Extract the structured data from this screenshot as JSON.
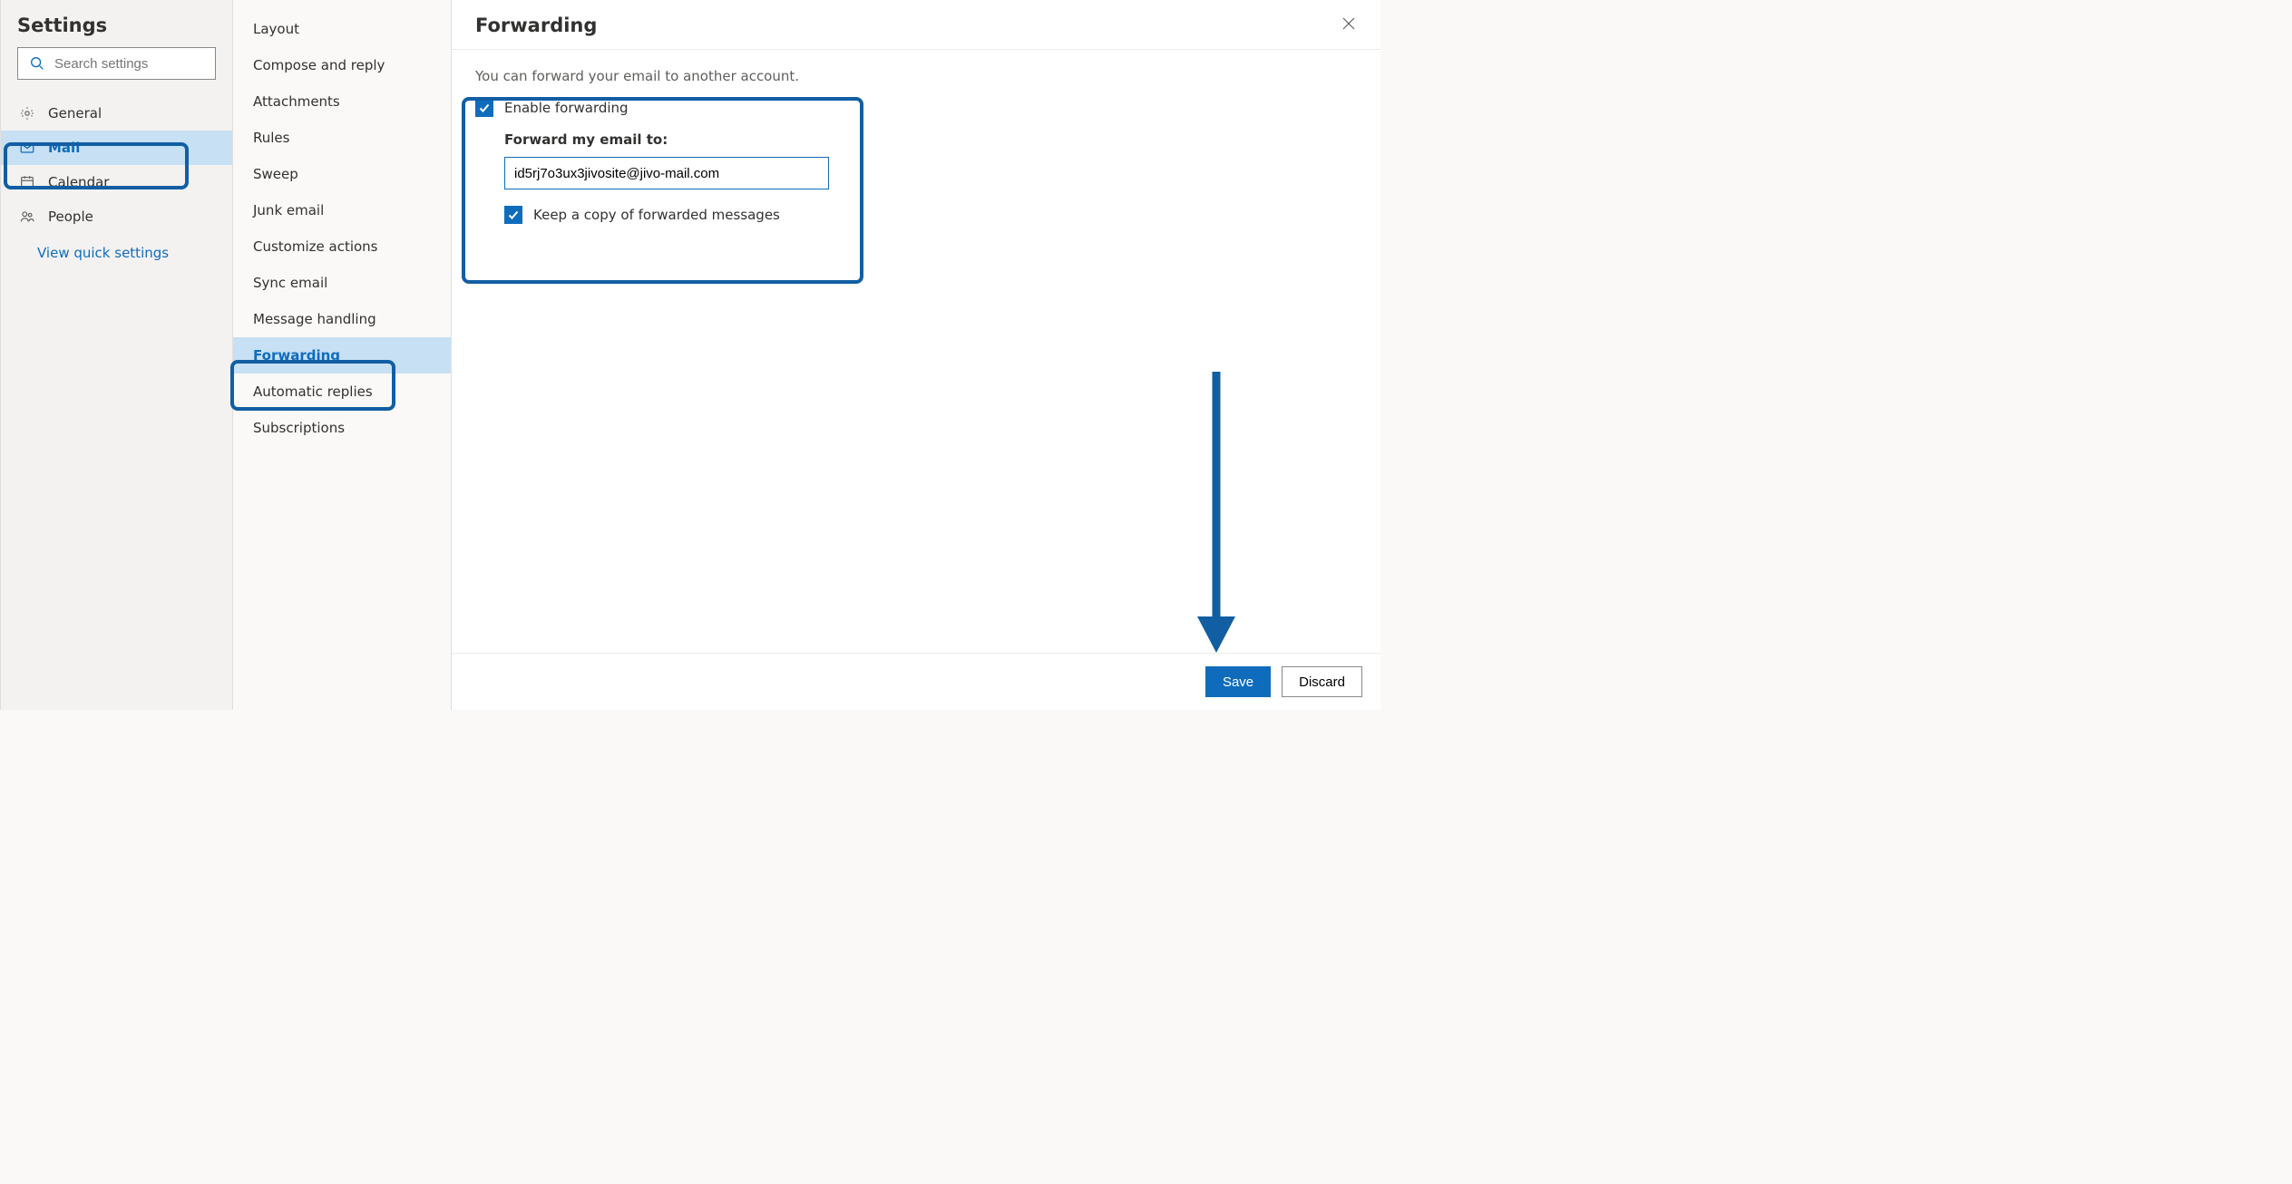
{
  "sidebar": {
    "title": "Settings",
    "search_placeholder": "Search settings",
    "categories": [
      {
        "label": "General"
      },
      {
        "label": "Mail"
      },
      {
        "label": "Calendar"
      },
      {
        "label": "People"
      }
    ],
    "quick_link": "View quick settings"
  },
  "sublist": {
    "items": [
      "Layout",
      "Compose and reply",
      "Attachments",
      "Rules",
      "Sweep",
      "Junk email",
      "Customize actions",
      "Sync email",
      "Message handling",
      "Forwarding",
      "Automatic replies",
      "Subscriptions"
    ]
  },
  "pane": {
    "title": "Forwarding",
    "description": "You can forward your email to another account.",
    "enable_label": "Enable forwarding",
    "forward_to_label": "Forward my email to:",
    "forward_to_value": "id5rj7o3ux3jivosite@jivo-mail.com",
    "keep_copy_label": "Keep a copy of forwarded messages",
    "save_label": "Save",
    "discard_label": "Discard"
  },
  "colors": {
    "accent": "#0f6cbd",
    "highlight_border": "#115ea3"
  }
}
